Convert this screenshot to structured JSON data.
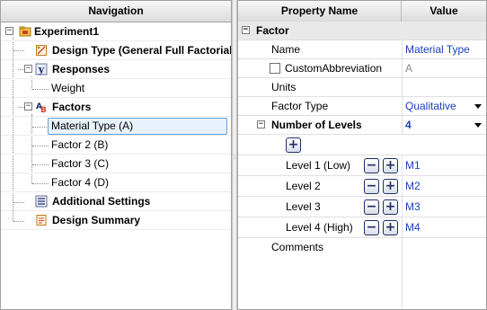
{
  "navigation": {
    "header": "Navigation",
    "items": [
      {
        "label": "Experiment1",
        "expander": "−",
        "icon": "experiment-folder-icon"
      },
      {
        "label": "Design Type (General Full Factorial)",
        "icon": "design-type-icon"
      },
      {
        "label": "Responses",
        "expander": "−",
        "icon": "responses-y-icon"
      },
      {
        "label": "Weight"
      },
      {
        "label": "Factors",
        "expander": "−",
        "icon": "factors-ab-icon"
      },
      {
        "label": "Material Type (A)",
        "selected": true
      },
      {
        "label": "Factor 2 (B)"
      },
      {
        "label": "Factor 3 (C)"
      },
      {
        "label": "Factor 4 (D)"
      },
      {
        "label": "Additional Settings",
        "icon": "settings-list-icon"
      },
      {
        "label": "Design Summary",
        "icon": "design-summary-icon"
      }
    ]
  },
  "property_grid": {
    "col_name": "Property Name",
    "col_value": "Value",
    "category": {
      "label": "Factor",
      "expander": "−"
    },
    "rows": {
      "name": {
        "label": "Name",
        "value": "Material Type"
      },
      "custom_abbreviation": {
        "label": "CustomAbbreviation",
        "value": "A",
        "checked": false
      },
      "units": {
        "label": "Units",
        "value": ""
      },
      "factor_type": {
        "label": "Factor Type",
        "value": "Qualitative"
      },
      "number_of_levels": {
        "label": "Number of Levels",
        "value": "4",
        "expander": "−"
      },
      "add_level": {
        "symbol": "+"
      },
      "levels": [
        {
          "label": "Level 1 (Low)",
          "value": "M1",
          "minus": "−",
          "plus": "+"
        },
        {
          "label": "Level 2",
          "value": "M2",
          "minus": "−",
          "plus": "+"
        },
        {
          "label": "Level 3",
          "value": "M3",
          "minus": "−",
          "plus": "+"
        },
        {
          "label": "Level 4 (High)",
          "value": "M4",
          "minus": "−",
          "plus": "+"
        }
      ],
      "comments": {
        "label": "Comments",
        "value": ""
      }
    }
  },
  "colors": {
    "value_text": "#1a3fbf",
    "selection_border": "#6a9fd4",
    "selection_fill": "#e8f2fc",
    "category_bg": "#e9e9e9"
  }
}
